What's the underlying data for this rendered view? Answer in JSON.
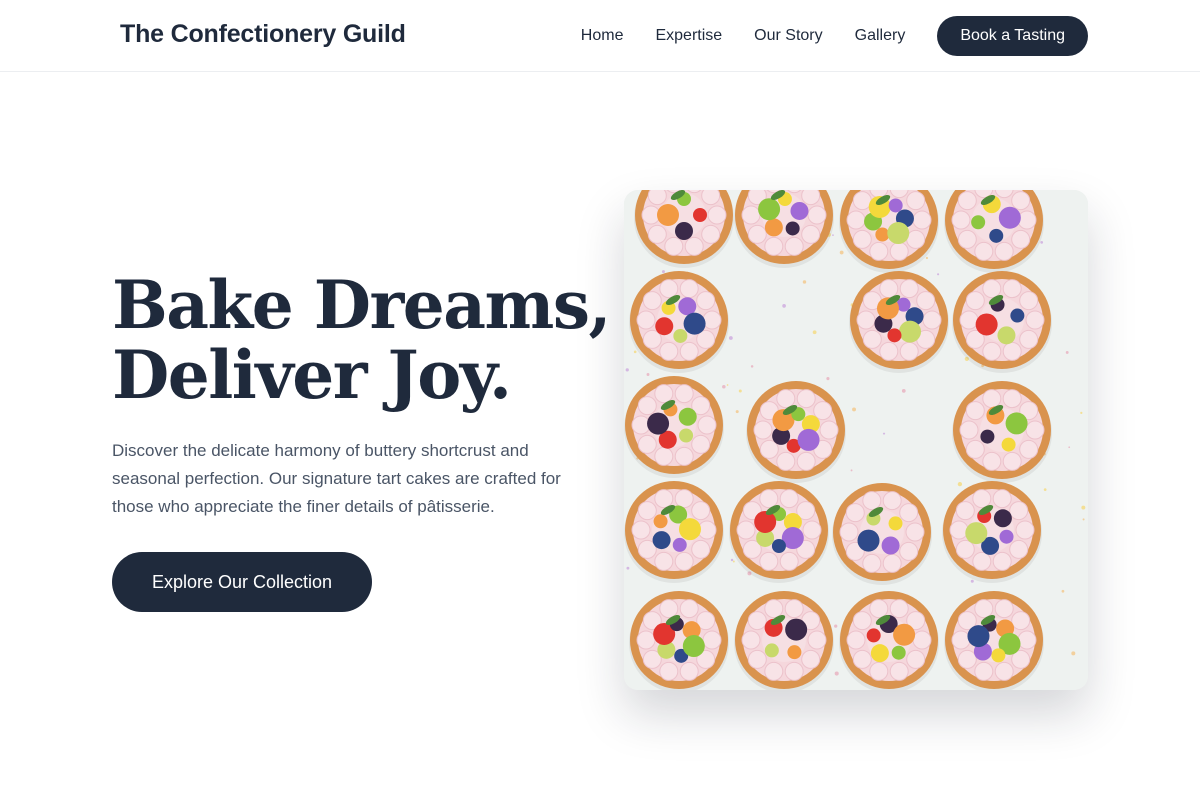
{
  "header": {
    "brand": "The Confectionery Guild",
    "nav": [
      {
        "label": "Home"
      },
      {
        "label": "Expertise"
      },
      {
        "label": "Our Story"
      },
      {
        "label": "Gallery"
      }
    ],
    "cta_label": "Book a Tasting"
  },
  "hero": {
    "title_line1": "Bake Dreams,",
    "title_line2": "Deliver Joy.",
    "description": "Discover the delicate harmony of buttery shortcrust and seasonal perfection. Our signature tart cakes are crafted for those who appreciate the finer details of pâtisserie.",
    "cta_label": "Explore Our Collection"
  },
  "colors": {
    "primary": "#1f2a3c",
    "text_muted": "#4a5566",
    "background": "#ffffff"
  }
}
